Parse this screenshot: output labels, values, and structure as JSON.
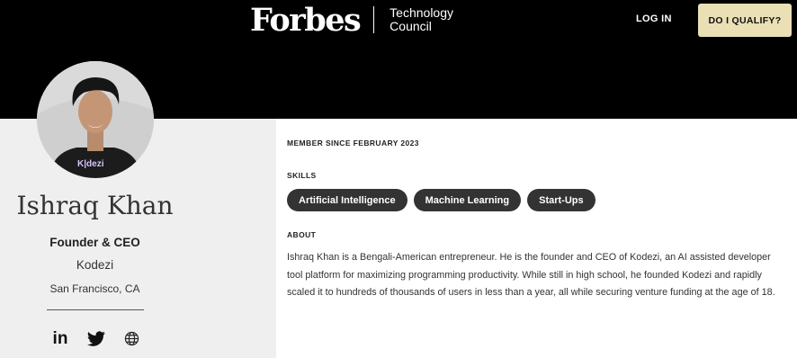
{
  "header": {
    "logo_word": "Forbes",
    "logo_sub_line1": "Technology",
    "logo_sub_line2": "Council",
    "login_label": "LOG IN",
    "qualify_label": "DO I QUALIFY?",
    "colors": {
      "bar": "#000000",
      "qualify_bg": "#eadfb5"
    }
  },
  "profile": {
    "avatar_icon": "profile-photo",
    "shirt_text": "K|dezi",
    "name": "Ishraq Khan",
    "title": "Founder & CEO",
    "company": "Kodezi",
    "location": "San Francisco, CA",
    "social": [
      {
        "icon": "linkedin-icon",
        "glyph": "in"
      },
      {
        "icon": "twitter-icon"
      },
      {
        "icon": "globe-icon"
      }
    ]
  },
  "main": {
    "member_since": "MEMBER SINCE FEBRUARY 2023",
    "skills_label": "SKILLS",
    "skills": [
      "Artificial Intelligence",
      "Machine Learning",
      "Start-Ups"
    ],
    "about_label": "ABOUT",
    "about_text": "Ishraq Khan is a Bengali-American entrepreneur. He is the founder and CEO of Kodezi, an AI assisted developer tool platform for maximizing programming productivity. While still in high school, he founded Kodezi and rapidly scaled it to hundreds of thousands of users in less than a year, all while securing venture funding at the age of 18."
  }
}
